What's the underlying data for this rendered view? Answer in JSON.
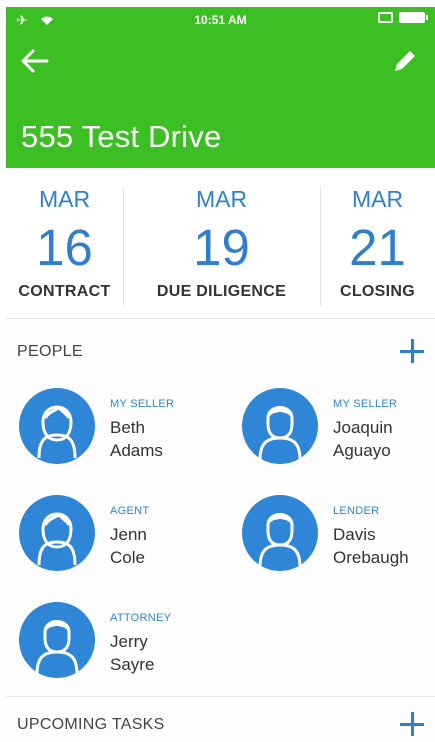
{
  "status_bar": {
    "time": "10:51 AM"
  },
  "header": {
    "title": "555 Test Drive",
    "background_color": "#3cbf22"
  },
  "dates": [
    {
      "month": "MAR",
      "day": "16",
      "label": "CONTRACT"
    },
    {
      "month": "MAR",
      "day": "19",
      "label": "DUE DILIGENCE"
    },
    {
      "month": "MAR",
      "day": "21",
      "label": "CLOSING"
    }
  ],
  "people_section": {
    "title": "PEOPLE",
    "people": [
      {
        "role": "MY SELLER",
        "first": "Beth",
        "last": "Adams",
        "avatar": "female-avatar-icon"
      },
      {
        "role": "MY SELLER",
        "first": "Joaquin",
        "last": "Aguayo",
        "avatar": "male-avatar-icon"
      },
      {
        "role": "AGENT",
        "first": "Jenn",
        "last": "Cole",
        "avatar": "female-avatar-icon"
      },
      {
        "role": "LENDER",
        "first": "Davis",
        "last": "Orebaugh",
        "avatar": "male-avatar-icon"
      },
      {
        "role": "ATTORNEY",
        "first": "Jerry",
        "last": "Sayre",
        "avatar": "male-avatar-icon"
      }
    ]
  },
  "tasks_section": {
    "title": "UPCOMING TASKS"
  },
  "colors": {
    "accent_blue": "#2f7fce",
    "brand_green": "#3cbf22"
  }
}
